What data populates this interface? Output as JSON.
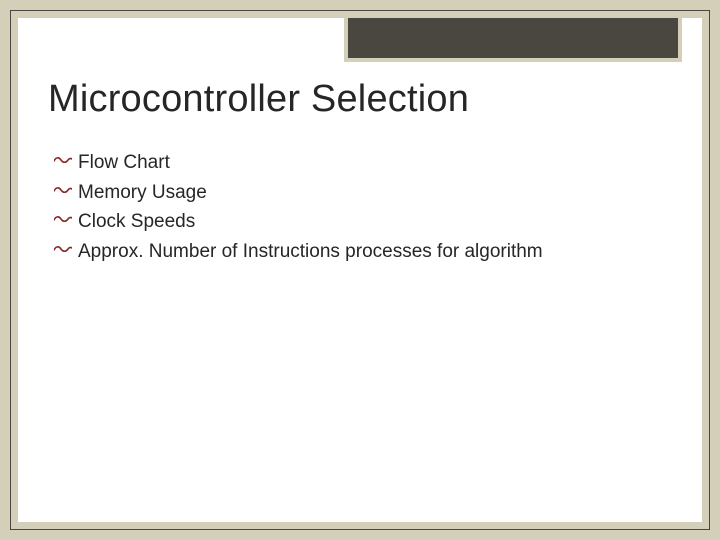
{
  "title": "Microcontroller Selection",
  "bullets": [
    "Flow Chart",
    "Memory Usage",
    "Clock Speeds",
    "Approx. Number of Instructions processes for algorithm"
  ]
}
